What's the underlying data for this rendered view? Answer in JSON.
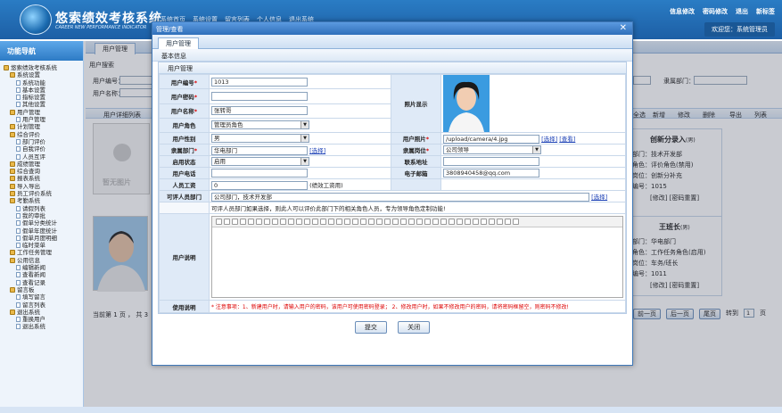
{
  "app": {
    "title": "悠索绩效考核系统",
    "subtitle": "CAREER NEW PERFORMANCE INDICATOR",
    "topnav": [
      "系统首页",
      "系统设置",
      "留言列表",
      "个人信息",
      "退出系统"
    ],
    "toplinks": [
      "信息修改",
      "密码修改",
      "退出",
      "新标签"
    ],
    "welcome": "欢迎您：系统管理员"
  },
  "sidebar": {
    "title": "功能导航",
    "items": [
      "悠索绩效考核系统",
      "系统设置",
      "系统功能",
      "基本设置",
      "指标设置",
      "其他设置",
      "用户管理",
      "用户管理",
      "计划管理",
      "综合评价",
      "部门评价",
      "自我评价",
      "人员互评",
      "成绩管理",
      "综合查询",
      "报表系统",
      "导入导出",
      "员工评价系统",
      "考勤系统",
      "请假列表",
      "我的审批",
      "假单分类统计",
      "假单年度统计",
      "假单月度明细",
      "临时菜单",
      "工作任务管理",
      "公用信息",
      "编辑新闻",
      "查看新闻",
      "查看记录",
      "留言板",
      "填写留言",
      "留言列表",
      "退出系统",
      "重换用户",
      "退出系统"
    ]
  },
  "main": {
    "tab": "用户管理",
    "search_title": "用户搜索",
    "search_labels": [
      "用户编号：",
      "用户名称：",
      "隶属部门："
    ],
    "list_title": "用户详细列表",
    "toolbar": [
      "全选",
      "新增",
      "修改",
      "删除",
      "导出",
      "列表"
    ],
    "no_photo": "暂无图片",
    "cards": [
      {
        "name": "创新分录入",
        "sex": "(男)",
        "dept": "部门：技术开发部",
        "role": "角色：评价角色(禁用)",
        "post": "岗位：创新分补充",
        "id": "编号：1015",
        "actions": "[修改] [密码重置]"
      },
      {
        "name": "王班长",
        "sex": "(男)",
        "dept": "部门：华电部门",
        "role": "角色：工作任务角色(启用)",
        "post": "岗位：车务/班长",
        "id": "编号：1011",
        "actions": "[修改] [密码重置]"
      }
    ],
    "pager": "当前第 1 页 ， 共 3",
    "pager_buttons": [
      "前一页",
      "后一页",
      "尾页"
    ],
    "goto_label": "转到",
    "goto_page": "1",
    "goto_unit": "页"
  },
  "modal": {
    "title": "管理/查看",
    "tab": "用户管理",
    "section": "基本信息",
    "subsection": "用户管理",
    "labels": {
      "user_no": "用户编号",
      "password": "用户密码",
      "user_name": "用户名称",
      "role": "用户角色",
      "photo_show": "照片显示",
      "gender": "用户性别",
      "photo": "用户照片",
      "dept": "隶属部门",
      "post": "隶属岗位",
      "status": "启用状态",
      "contact": "联系地址",
      "phone": "用户电话",
      "email": "电子邮箱",
      "wage": "人员工资",
      "eval_dept": "可评人员部门",
      "remark": "用户说明",
      "usage": "使用说明"
    },
    "values": {
      "user_no": "1013",
      "password": "",
      "user_name": "张转哥",
      "role": "管理员角色",
      "gender": "男",
      "photo": "/upload/camera/4.jpg",
      "dept": "华电部门",
      "post": "公司领导",
      "status": "启用",
      "contact": "",
      "phone": "",
      "email": "3808940458@qq.com",
      "wage": "0",
      "wage_note": "(绩效工资用)",
      "eval_dept": "公司部门，技术开发部"
    },
    "links": {
      "select": "[选择]",
      "view": "[查看]"
    },
    "eval_hint": "可评人员部门如果选择，则此人可以评价此部门下的相关角色人员，专为领导角色定制功能!",
    "notice": "* 注意事项：1、新建用户时，请输入用户的密码，该用户可使用密码登录； 2、修改用户时，如果不修改用户的密码，请将密码框留空，则密码不修改!",
    "buttons": {
      "submit": "提交",
      "close": "关闭"
    }
  }
}
